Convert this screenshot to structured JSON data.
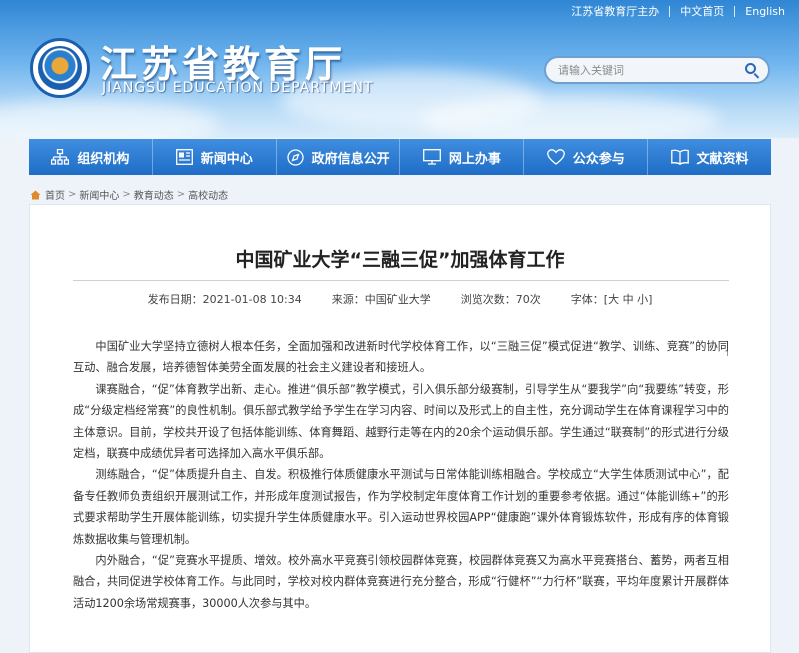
{
  "topbar": {
    "sponsor": "江苏省教育厅主办",
    "home_cn": "中文首页",
    "english": "English"
  },
  "brand": {
    "title": "江苏省教育厅",
    "subtitle": "JIANGSU EDUCATION DEPARTMENT"
  },
  "search": {
    "placeholder": "请输入关键词"
  },
  "nav": {
    "items": [
      {
        "label": "组织机构",
        "icon": "org-chart-icon"
      },
      {
        "label": "新闻中心",
        "icon": "news-icon"
      },
      {
        "label": "政府信息公开",
        "icon": "info-disclosure-icon"
      },
      {
        "label": "网上办事",
        "icon": "monitor-icon"
      },
      {
        "label": "公众参与",
        "icon": "heart-icon"
      },
      {
        "label": "文献资料",
        "icon": "book-icon"
      }
    ]
  },
  "breadcrumb": {
    "items": [
      "首页",
      "新闻中心",
      "教育动态",
      "高校动态"
    ],
    "separator": ">"
  },
  "article": {
    "title": "中国矿业大学“三融三促”加强体育工作",
    "publish": "发布日期：2021-01-08 10:34",
    "source": "来源：中国矿业大学",
    "views": "浏览次数：70次",
    "font_label": "字体：[",
    "font_large": "大",
    "font_medium": "中",
    "font_small": "小",
    "font_end": "]",
    "paragraphs": [
      "中国矿业大学坚持立德树人根本任务，全面加强和改进新时代学校体育工作，以“三融三促”模式促进“教学、训练、竞赛”的协同互动、融合发展，培养德智体美劳全面发展的社会主义建设者和接班人。",
      "课赛融合，“促”体育教学出新、走心。推进“俱乐部”教学模式，引入俱乐部分级赛制，引导学生从“要我学”向“我要练”转变，形成“分级定档经常赛”的良性机制。俱乐部式教学给予学生在学习内容、时间以及形式上的自主性，充分调动学生在体育课程学习中的主体意识。目前，学校共开设了包括体能训练、体育舞蹈、越野行走等在内的20余个运动俱乐部。学生通过“联赛制”的形式进行分级定档，联赛中成绩优异者可选择加入高水平俱乐部。",
      "测练融合，“促”体质提升自主、自发。积极推行体质健康水平测试与日常体能训练相融合。学校成立“大学生体质测试中心”，配备专任教师负责组织开展测试工作，并形成年度测试报告，作为学校制定年度体育工作计划的重要参考依据。通过“体能训练+”的形式要求帮助学生开展体能训练，切实提升学生体质健康水平。引入运动世界校园APP“健康跑”课外体育锻炼软件，形成有序的体育锻炼数据收集与管理机制。",
      "内外融合，“促”竞赛水平提质、增效。校外高水平竞赛引领校园群体竞赛，校园群体竞赛又为高水平竞赛搭台、蓄势，两者互相融合，共同促进学校体育工作。与此同时，学校对校内群体竞赛进行充分整合，形成“行健杯”“力行杯”联赛，平均年度累计开展群体活动1200余场常规赛事，30000人次参与其中。"
    ]
  },
  "colors": {
    "nav_top": "#3f8ee0",
    "nav_bottom": "#1f6dc6",
    "header_top": "#2f86d4",
    "logo_ring": "#1a5fb0"
  }
}
